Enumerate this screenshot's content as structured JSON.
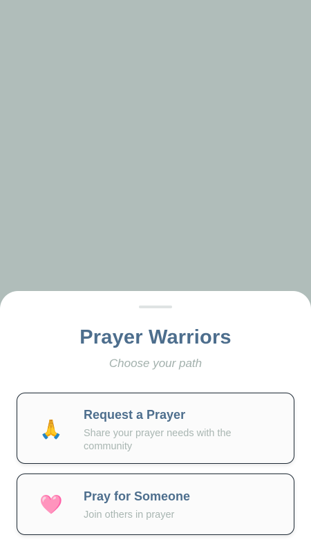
{
  "colors": {
    "backdrop": "#b0bdba",
    "sheet": "#ffffff",
    "title": "#4d6e8d",
    "muted_text": "#a3b1ad",
    "card_border": "#1e2a35"
  },
  "sheet": {
    "title": "Prayer Warriors",
    "subtitle": "Choose your path"
  },
  "options": [
    {
      "icon": "praying-hands-icon",
      "glyph": "🙏",
      "title": "Request a Prayer",
      "description": "Share your prayer needs with the community"
    },
    {
      "icon": "pink-heart-icon",
      "glyph": "🩷",
      "title": "Pray for Someone",
      "description": "Join others in prayer"
    }
  ]
}
